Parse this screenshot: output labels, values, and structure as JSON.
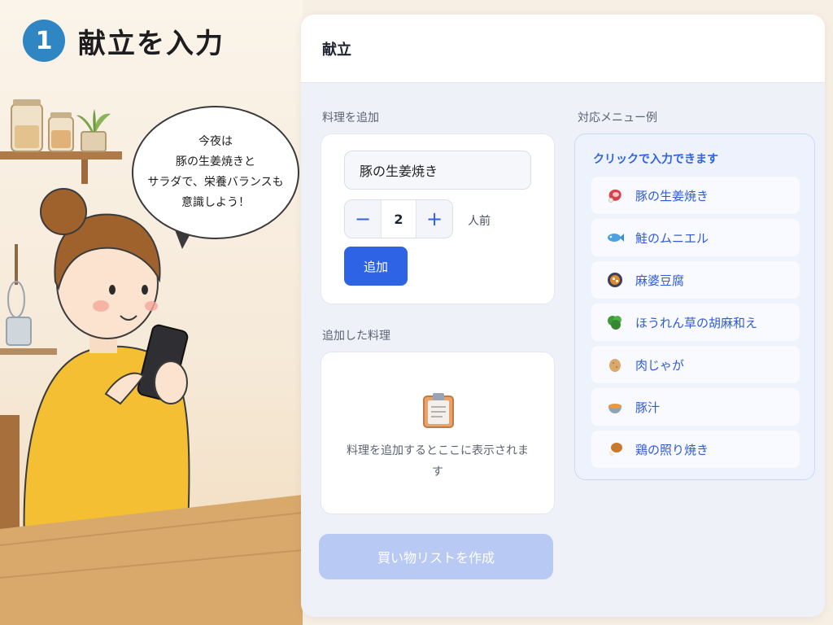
{
  "step": {
    "number": "1",
    "title": "献立を入力"
  },
  "bubble": {
    "text": "今夜は\n豚の生姜焼きと\nサラダで、栄養バランスも\n意識しよう！"
  },
  "app": {
    "title": "献立",
    "add_section": {
      "label": "料理を追加",
      "dish_value": "豚の生姜焼き",
      "servings": "2",
      "servings_unit": "人前",
      "decrement_symbol": "−",
      "increment_symbol": "+",
      "add_label": "追加"
    },
    "added_section": {
      "label": "追加した料理",
      "empty_icon": "clipboard-icon",
      "empty_text": "料理を追加するとここに表示されます"
    },
    "create_button": "買い物リストを作成",
    "menu_examples": {
      "label": "対応メニュー例",
      "hint": "クリックで入力できます",
      "items": [
        {
          "label": "豚の生姜焼き",
          "icon": "meat-icon"
        },
        {
          "label": "鮭のムニエル",
          "icon": "fish-icon"
        },
        {
          "label": "麻婆豆腐",
          "icon": "mapo-bowl-icon"
        },
        {
          "label": "ほうれん草の胡麻和え",
          "icon": "spinach-icon"
        },
        {
          "label": "肉じゃが",
          "icon": "potato-icon"
        },
        {
          "label": "豚汁",
          "icon": "soup-bowl-icon"
        },
        {
          "label": "鶏の照り焼き",
          "icon": "chicken-leg-icon"
        }
      ]
    }
  },
  "colors": {
    "accent": "#2f63e6",
    "step_badge": "#2f86c2",
    "disabled_button": "#b8c9f4"
  }
}
